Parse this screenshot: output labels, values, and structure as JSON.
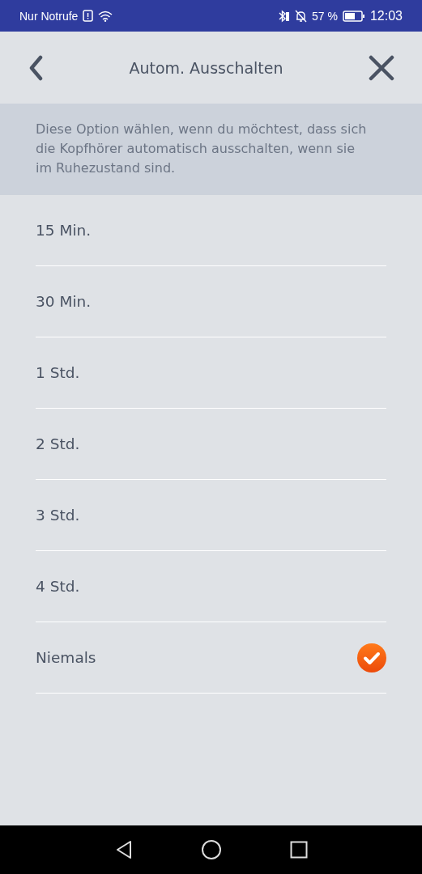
{
  "status_bar": {
    "carrier": "Nur Notrufe",
    "battery": "57 %",
    "time": "12:03"
  },
  "header": {
    "title": "Autom. Ausschalten"
  },
  "description": "Diese Option wählen, wenn du möchtest, dass sich die Kopfhörer automatisch ausschalten, wenn sie im Ruhezustand sind.",
  "options": [
    {
      "label": "15 Min.",
      "selected": false
    },
    {
      "label": "30 Min.",
      "selected": false
    },
    {
      "label": "1 Std.",
      "selected": false
    },
    {
      "label": "2 Std.",
      "selected": false
    },
    {
      "label": "3 Std.",
      "selected": false
    },
    {
      "label": "4 Std.",
      "selected": false
    },
    {
      "label": "Niemals",
      "selected": true
    }
  ]
}
